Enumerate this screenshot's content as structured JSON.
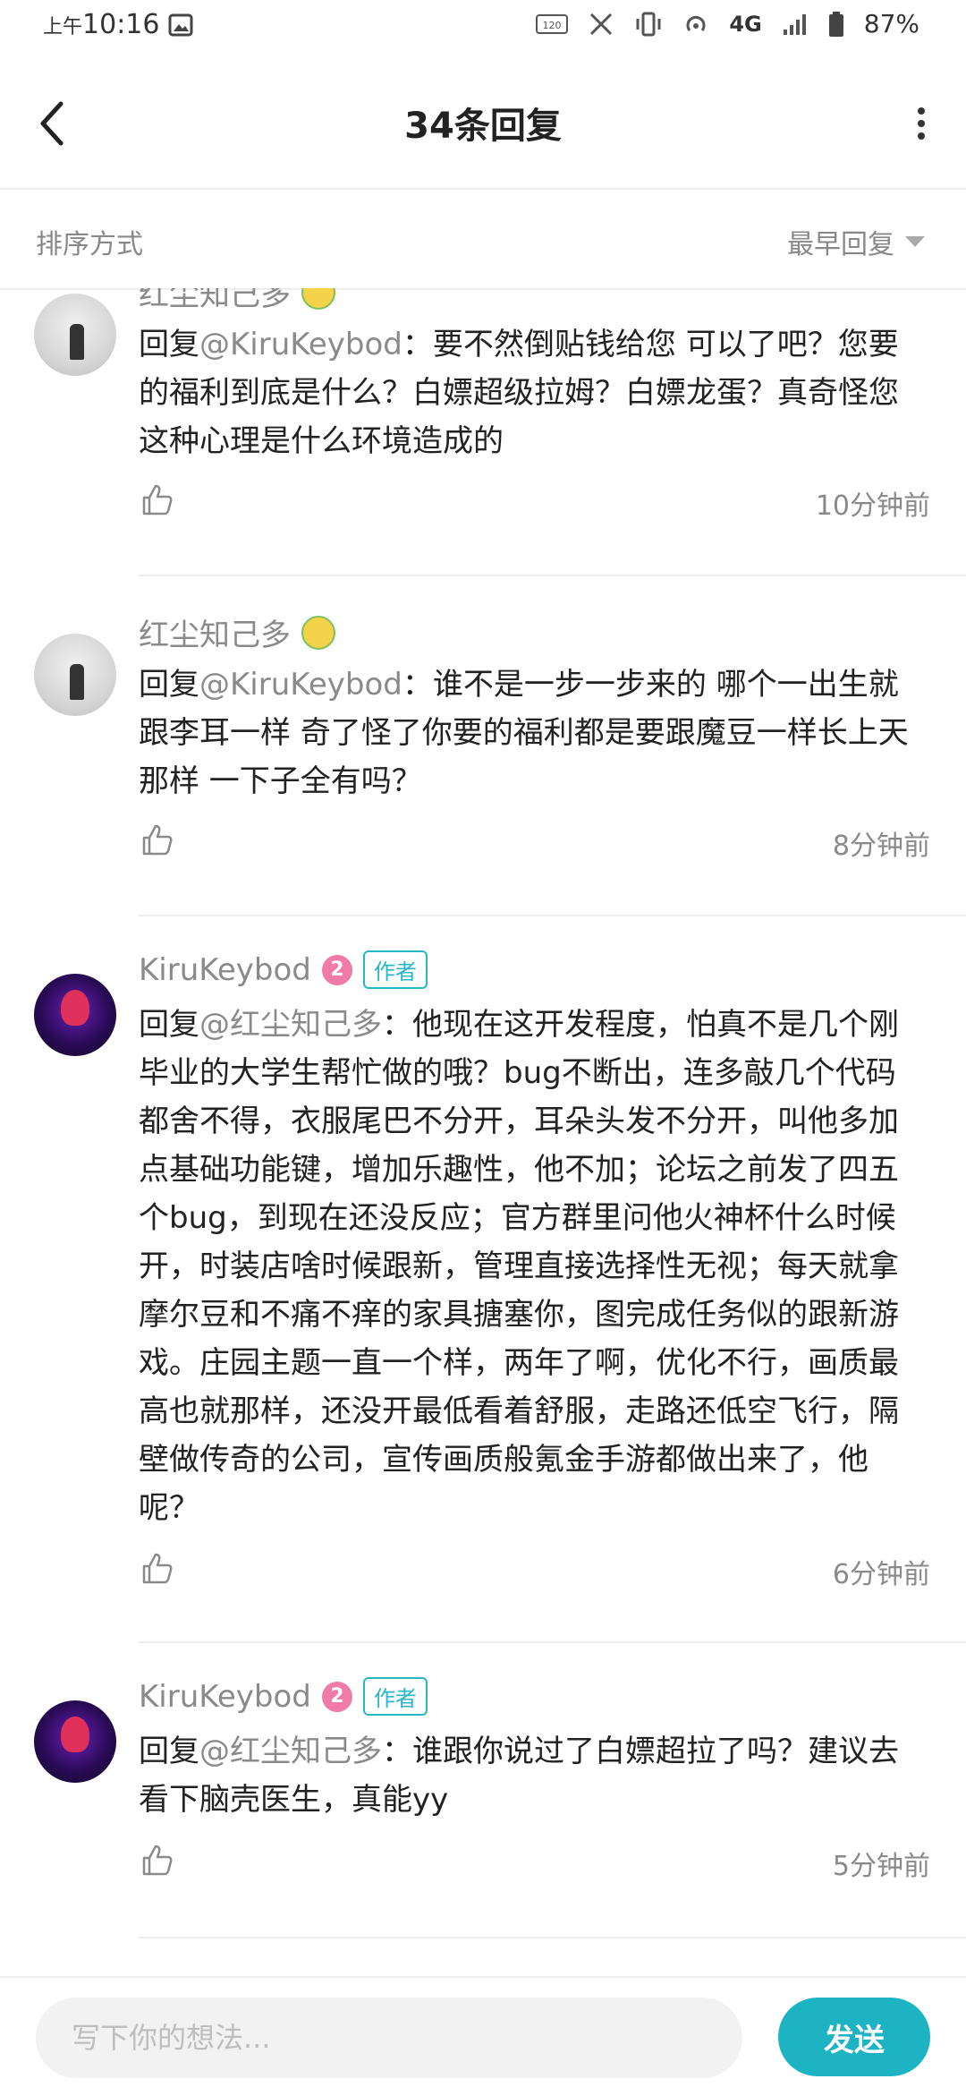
{
  "status_bar": {
    "ampm": "上午",
    "time": "10:16",
    "battery": "87%",
    "network": "4G",
    "icons": [
      "image-icon",
      "hd-voice-icon",
      "x-app-icon",
      "vibrate-icon",
      "hotspot-icon",
      "signal-icon",
      "battery-icon"
    ]
  },
  "header": {
    "title": "34条回复"
  },
  "sort": {
    "label": "排序方式",
    "value": "最早回复"
  },
  "replies": [
    {
      "name": "红尘知己多",
      "reply_prefix": "回复",
      "mention": "@KiruKeybod",
      "text": "：要不然倒贴钱给您 可以了吧？您要的福利到底是什么？白嫖超级拉姆？白嫖龙蛋？真奇怪您这种心理是什么环境造成的",
      "time": "10分钟前"
    },
    {
      "name": "红尘知己多",
      "reply_prefix": "回复",
      "mention": "@KiruKeybod",
      "text": "：谁不是一步一步来的 哪个一出生就跟李耳一样 奇了怪了你要的福利都是要跟魔豆一样长上天那样 一下子全有吗？",
      "time": "8分钟前"
    },
    {
      "name": "KiruKeybod",
      "level": "2",
      "badge": "作者",
      "reply_prefix": "回复",
      "mention": "@红尘知己多",
      "text": "：他现在这开发程度，怕真不是几个刚毕业的大学生帮忙做的哦？bug不断出，连多敲几个代码都舍不得，衣服尾巴不分开，耳朵头发不分开，叫他多加点基础功能键，增加乐趣性，他不加；论坛之前发了四五个bug，到现在还没反应；官方群里问他火神杯什么时候开，时装店啥时候跟新，管理直接选择性无视；每天就拿摩尔豆和不痛不痒的家具搪塞你，图完成任务似的跟新游戏。庄园主题一直一个样，两年了啊，优化不行，画质最高也就那样，还没开最低看着舒服，走路还低空飞行，隔壁做传奇的公司，宣传画质般氪金手游都做出来了，他呢？",
      "time": "6分钟前"
    },
    {
      "name": "KiruKeybod",
      "level": "2",
      "badge": "作者",
      "reply_prefix": "回复",
      "mention": "@红尘知己多",
      "text": "：谁跟你说过了白嫖超拉了吗？建议去看下脑壳医生，真能yy",
      "time": "5分钟前"
    }
  ],
  "composer": {
    "placeholder": "写下你的想法...",
    "send_label": "发送"
  }
}
